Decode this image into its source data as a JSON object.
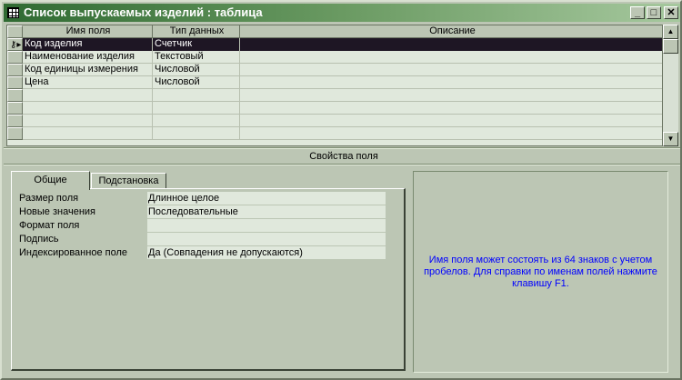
{
  "window": {
    "title": "Список выпускаемых изделий : таблица",
    "minimize": "_",
    "maximize": "□",
    "close": "✕"
  },
  "grid": {
    "columns": [
      "Имя поля",
      "Тип данных",
      "Описание"
    ],
    "rows": [
      {
        "name": "Код изделия",
        "type": "Счетчик",
        "desc": ""
      },
      {
        "name": "Наименование изделия",
        "type": "Текстовый",
        "desc": ""
      },
      {
        "name": "Код единицы измерения",
        "type": "Числовой",
        "desc": ""
      },
      {
        "name": "Цена",
        "type": "Числовой",
        "desc": ""
      }
    ]
  },
  "properties": {
    "title": "Свойства поля",
    "tabs": [
      "Общие",
      "Подстановка"
    ],
    "fields": [
      {
        "label": "Размер поля",
        "value": "Длинное целое"
      },
      {
        "label": "Новые значения",
        "value": "Последовательные"
      },
      {
        "label": "Формат поля",
        "value": ""
      },
      {
        "label": "Подпись",
        "value": ""
      },
      {
        "label": "Индексированное поле",
        "value": "Да (Совпадения не допускаются)"
      }
    ],
    "help": "Имя поля может состоять из 64 знаков с учетом пробелов.  Для справки по именам полей нажмите клавишу F1."
  },
  "colors": {
    "help_text": "#0000ff",
    "selected_row": "#1e1624"
  }
}
